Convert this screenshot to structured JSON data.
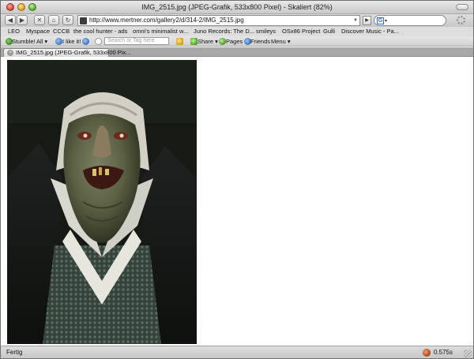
{
  "window": {
    "title": "IMG_2515.jpg (JPEG-Grafik, 533x800 Pixel) - Skaliert (82%)"
  },
  "toolbar": {
    "back": "◀",
    "forward": "▶",
    "stop": "✕",
    "home": "⌂",
    "reload": "↻",
    "url": "http://www.mertner.com/gallery2/d/314-2/IMG_2515.jpg",
    "go": "▶",
    "search_engine": "G",
    "search_value": "▾"
  },
  "bookmarks": [
    "LEO",
    "Myspace",
    "CCCB",
    "the cool hunter - ads",
    "omni's minimalist w...",
    "Juno Records: The D...",
    "smileys",
    "OSx86 Project",
    "Gulli",
    "Discover Music - Pa..."
  ],
  "stumble": {
    "stumble_label": "Stumble!",
    "all_label": "All ▾",
    "like_label": "I like it!",
    "search_placeholder": "Search or Tag here",
    "share_label": "Share ▾",
    "pages_label": "Pages",
    "friends_label": "Friends",
    "menu_label": "Menu ▾"
  },
  "tab": {
    "label": "IMG_2515.jpg (JPEG-Grafik, 533x800 Pix...",
    "close": "×"
  },
  "status": {
    "text": "Fertig",
    "time": "0.575s"
  },
  "image": {
    "alt": "IMG_2515.jpg"
  }
}
